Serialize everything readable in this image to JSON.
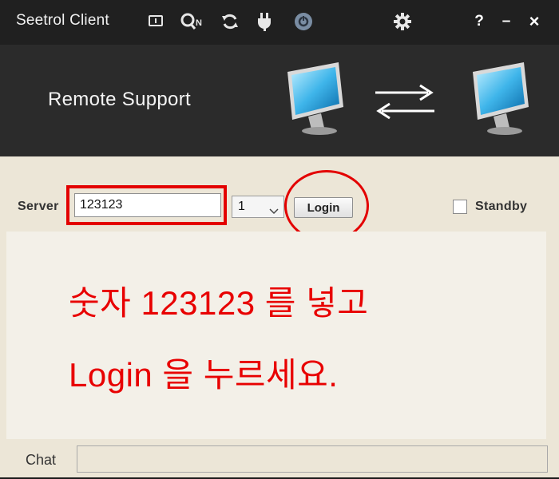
{
  "titlebar": {
    "title": "Seetrol Client",
    "icons": [
      "monitor-icon",
      "search-user-icon",
      "refresh-icon",
      "plug-icon",
      "power-icon",
      "gear-icon"
    ],
    "help_label": "?",
    "minimize_label": "–",
    "close_label": "×"
  },
  "banner": {
    "title": "Remote Support",
    "icons": [
      "monitor-icon",
      "transfer-arrows-icon",
      "monitor-icon"
    ]
  },
  "connection": {
    "server_label": "Server",
    "server_value": "123123",
    "session_value": "1",
    "login_label": "Login",
    "standby_label": "Standby",
    "standby_checked": false
  },
  "instruction": {
    "line1": "숫자 123123 를 넣고",
    "line2": "Login 을 누르세요."
  },
  "chat": {
    "label": "Chat",
    "value": ""
  },
  "colors": {
    "titlebar_bg": "#202020",
    "banner_bg": "#2b2b2b",
    "window_bg": "#ece6d7",
    "panel_bg": "#f3f0e8",
    "highlight": "#e30000"
  }
}
